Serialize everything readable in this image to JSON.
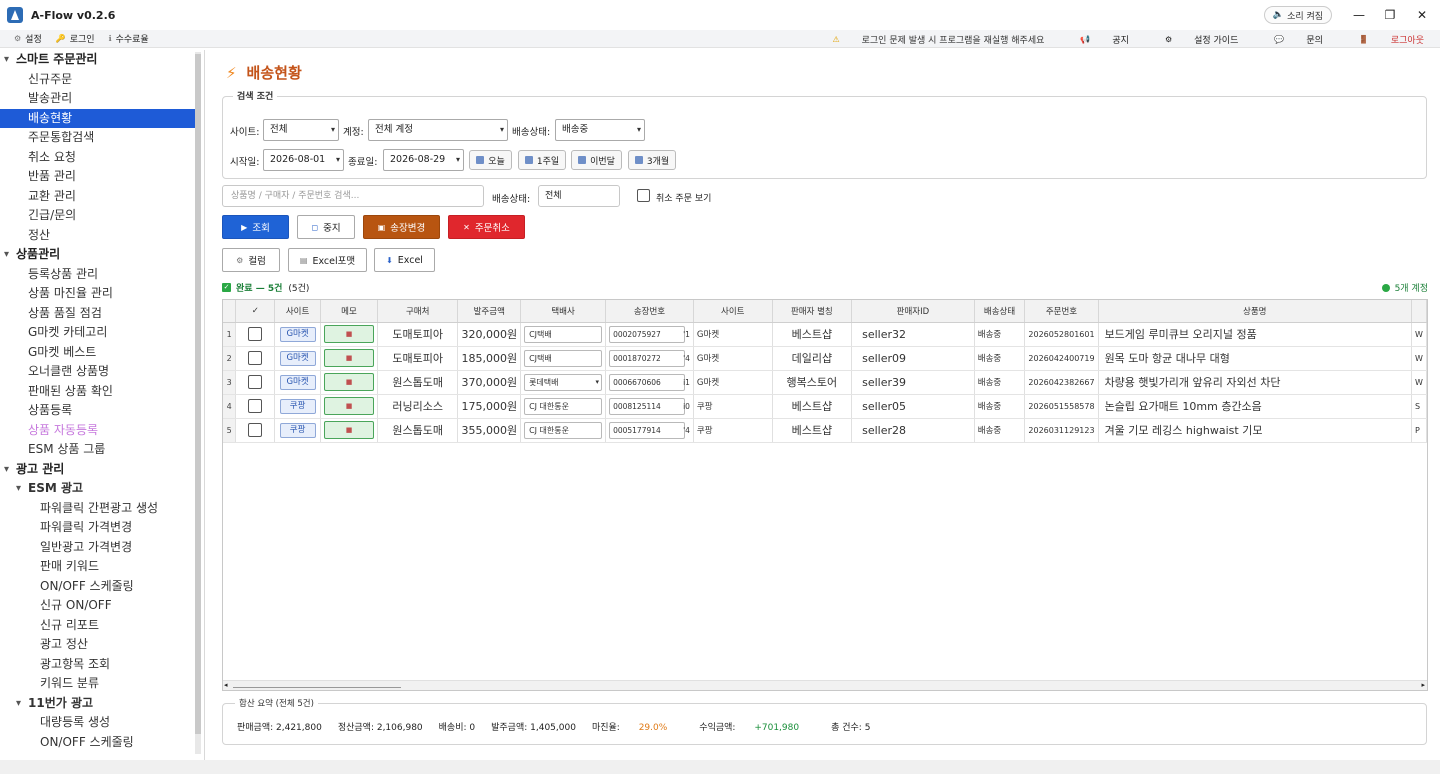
{
  "window": {
    "title": "A-Flow v0.2.6",
    "sound_label": "소리 켜짐"
  },
  "menubar": {
    "left": [
      {
        "icon": "gear-icon",
        "label": "설정"
      },
      {
        "icon": "key-icon",
        "label": "로그인"
      },
      {
        "icon": "info-icon",
        "label": "수수료율"
      }
    ],
    "warning": "로그인 문제 발생 시 프로그램을 재실행 해주세요",
    "notice": "공지",
    "guide": "설정 가이드",
    "inquiry": "문의",
    "logout": "로그아웃"
  },
  "sidebar": {
    "items": [
      {
        "level": "l0",
        "label": "스마트 주문관리"
      },
      {
        "level": "l1",
        "label": "신규주문"
      },
      {
        "level": "l1",
        "label": "발송관리"
      },
      {
        "level": "l1",
        "label": "배송현황",
        "selected": true
      },
      {
        "level": "l1",
        "label": "주문통합검색"
      },
      {
        "level": "l1",
        "label": "취소 요청"
      },
      {
        "level": "l1",
        "label": "반품 관리"
      },
      {
        "level": "l1",
        "label": "교환 관리"
      },
      {
        "level": "l1",
        "label": "긴급/문의"
      },
      {
        "level": "l1",
        "label": "정산"
      },
      {
        "level": "l0",
        "label": "상품관리"
      },
      {
        "level": "l1",
        "label": "등록상품 관리"
      },
      {
        "level": "l1",
        "label": "상품 마진율 관리"
      },
      {
        "level": "l1",
        "label": "상품 품질 점검"
      },
      {
        "level": "l1",
        "label": "G마켓 카테고리"
      },
      {
        "level": "l1",
        "label": "G마켓 베스트"
      },
      {
        "level": "l1",
        "label": "오너클랜 상품명"
      },
      {
        "level": "l1",
        "label": "판매된 상품 확인"
      },
      {
        "level": "l1",
        "label": "상품등록"
      },
      {
        "level": "l1",
        "label": "상품 자동등록",
        "pink": true
      },
      {
        "level": "l1",
        "label": "ESM 상품 그룹"
      },
      {
        "level": "l0",
        "label": "광고 관리"
      },
      {
        "level": "l1h",
        "label": "ESM 광고"
      },
      {
        "level": "l2",
        "label": "파워클릭 간편광고 생성"
      },
      {
        "level": "l2",
        "label": "파워클릭 가격변경"
      },
      {
        "level": "l2",
        "label": "일반광고 가격변경"
      },
      {
        "level": "l2",
        "label": "판매 키워드"
      },
      {
        "level": "l2",
        "label": "ON/OFF 스케줄링"
      },
      {
        "level": "l2",
        "label": "신규 ON/OFF"
      },
      {
        "level": "l2",
        "label": "신규 리포트"
      },
      {
        "level": "l2",
        "label": "광고 정산"
      },
      {
        "level": "l2",
        "label": "광고항목 조회"
      },
      {
        "level": "l2",
        "label": "키워드 분류"
      },
      {
        "level": "l1h",
        "label": "11번가 광고"
      },
      {
        "level": "l2",
        "label": "대량등록 생성"
      },
      {
        "level": "l2",
        "label": "ON/OFF 스케줄링"
      }
    ]
  },
  "page": {
    "title": "배송현황"
  },
  "filters": {
    "group_title": "검색 조건",
    "site_label": "사이트:",
    "site_value": "전체",
    "account_label": "계정:",
    "account_value": "전체 계정",
    "status_label": "배송상태:",
    "status_value": "배송중",
    "start_label": "시작일:",
    "start_value": "2026-08-01",
    "end_label": "종료일:",
    "end_value": "2026-08-29",
    "today": "오늘",
    "week": "1주일",
    "month": "이번달",
    "three_months": "3개월"
  },
  "search": {
    "placeholder": "상품명 / 구매자 / 주문번호 검색...",
    "status_label": "배송상태:",
    "status_value": "전체",
    "cancel_label": "취소 주문 보기"
  },
  "actions": {
    "query": "조회",
    "stop": "중지",
    "change_invoice": "송장변경",
    "cancel_order": "주문취소",
    "columns": "컬럼",
    "excel_format": "Excel포맷",
    "excel": "Excel"
  },
  "status": {
    "done": "완료 — 5건",
    "count": "(5건)",
    "accounts": "5개 계정"
  },
  "table": {
    "headers": [
      "",
      "✓",
      "사이트",
      "메모",
      "구매처",
      "발주금액",
      "택배사",
      "송장번호",
      "사이트",
      "판매자 별칭",
      "판매자ID",
      "배송상태",
      "주문번호",
      "상품명",
      ""
    ],
    "rows": [
      {
        "no": "1",
        "site": "G마켓",
        "buyer": "도매토피아",
        "amount": "320,000원",
        "courier": "CJ택배",
        "tracking": "0002075927",
        "tracking_tail": "'1",
        "site2": "G마켓",
        "alias": "베스트샵",
        "seller": "seller32",
        "status": "배송중",
        "order": "2026052801601",
        "product": "보드게임 루미큐브 오리지널 정품",
        "extra": "W"
      },
      {
        "no": "2",
        "site": "G마켓",
        "buyer": "도매토피아",
        "amount": "185,000원",
        "courier": "CJ택배",
        "tracking": "0001870272",
        "tracking_tail": "'4",
        "site2": "G마켓",
        "alias": "데일리샵",
        "seller": "seller09",
        "status": "배송중",
        "order": "2026042400719",
        "product": "원목 도마 항균 대나무 대형",
        "extra": "W"
      },
      {
        "no": "3",
        "site": "G마켓",
        "buyer": "원스톱도매",
        "amount": "370,000원",
        "courier": "롯데택배",
        "tracking": "0006670606",
        "tracking_tail": "i1",
        "site2": "G마켓",
        "alias": "행복스토어",
        "seller": "seller39",
        "status": "배송중",
        "order": "2026042382667",
        "product": "차량용 햇빛가리개 앞유리 자외선 차단",
        "extra": "W"
      },
      {
        "no": "4",
        "site": "쿠팡",
        "buyer": "러닝리소스",
        "amount": "175,000원",
        "courier": "CJ 대한통운",
        "tracking": "0008125114",
        "tracking_tail": "i0",
        "site2": "쿠팡",
        "alias": "베스트샵",
        "seller": "seller05",
        "status": "배송중",
        "order": "2026051558578",
        "product": "논슬립 요가매트 10mm 층간소음",
        "extra": "S"
      },
      {
        "no": "5",
        "site": "쿠팡",
        "buyer": "원스톱도매",
        "amount": "355,000원",
        "courier": "CJ 대한통운",
        "tracking": "0005177914",
        "tracking_tail": "'4",
        "site2": "쿠팡",
        "alias": "베스트샵",
        "seller": "seller28",
        "status": "배송중",
        "order": "2026031129123",
        "product": "겨울 기모 레깅스 highwaist 기모",
        "extra": "P"
      }
    ]
  },
  "summary": {
    "title": "합산 요약 (전체 5건)",
    "sales": "판매금액: 2,421,800",
    "settle": "정산금액: 2,106,980",
    "shipping": "배송비: 0",
    "order": "발주금액: 1,405,000",
    "margin_label": "마진율:",
    "margin_value": "29.0%",
    "profit_label": "수익금액:",
    "profit_value": "+701,980",
    "total": "총 건수: 5"
  }
}
